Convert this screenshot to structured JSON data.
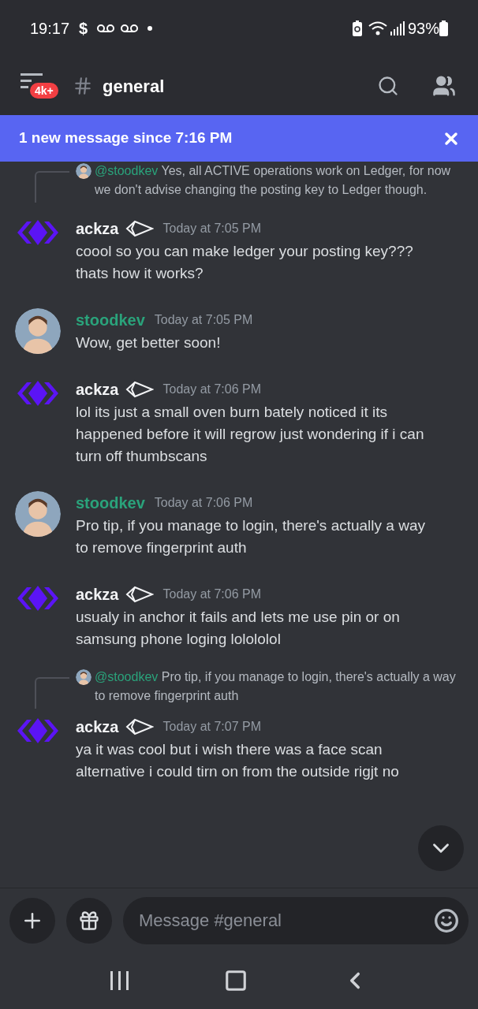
{
  "status_bar": {
    "time": "19:17",
    "notification": "$",
    "battery": "93%"
  },
  "header": {
    "badge": "4k+",
    "channel": "general"
  },
  "banner": {
    "text": "1 new message since 7:16 PM"
  },
  "top_reply": {
    "mention": "@stoodkev",
    "text": "Yes, all ACTIVE operations work on Ledger, for now we don't advise changing the posting key to Ledger though."
  },
  "messages": [
    {
      "author": "ackza",
      "kind": "logo",
      "has_badge": true,
      "color": "#f2f3f5",
      "time": "Today at 7:05 PM",
      "text": "coool so you can make ledger your posting key??? thats how it works?"
    },
    {
      "author": "stoodkev",
      "kind": "person",
      "has_badge": false,
      "color": "#2aa37b",
      "time": "Today at 7:05 PM",
      "text": "Wow, get better soon!"
    },
    {
      "author": "ackza",
      "kind": "logo",
      "has_badge": true,
      "color": "#f2f3f5",
      "time": "Today at 7:06 PM",
      "text": "lol its just a small oven burn bately noticed it  its happened before it will regrow just wondering if i can turn off thumbscans"
    },
    {
      "author": "stoodkev",
      "kind": "person",
      "has_badge": false,
      "color": "#2aa37b",
      "time": "Today at 7:06 PM",
      "text": "Pro tip, if you manage to login, there's actually a way to remove fingerprint auth"
    },
    {
      "author": "ackza",
      "kind": "logo",
      "has_badge": true,
      "color": "#f2f3f5",
      "time": "Today at 7:06 PM",
      "text": "usualy in anchor it fails and lets me use pin or on samsung phone loging lolololol"
    },
    {
      "author": "ackza",
      "kind": "logo",
      "has_badge": true,
      "color": "#f2f3f5",
      "time": "Today at 7:07 PM",
      "text": "ya it was cool but i wish there was a face scan alternative i could tirn on from the outside rigjt no",
      "reply": {
        "mention": "@stoodkev",
        "text": "Pro tip, if you manage to login, there's actually a way to remove fingerprint auth"
      }
    }
  ],
  "composer": {
    "placeholder": "Message #general"
  }
}
